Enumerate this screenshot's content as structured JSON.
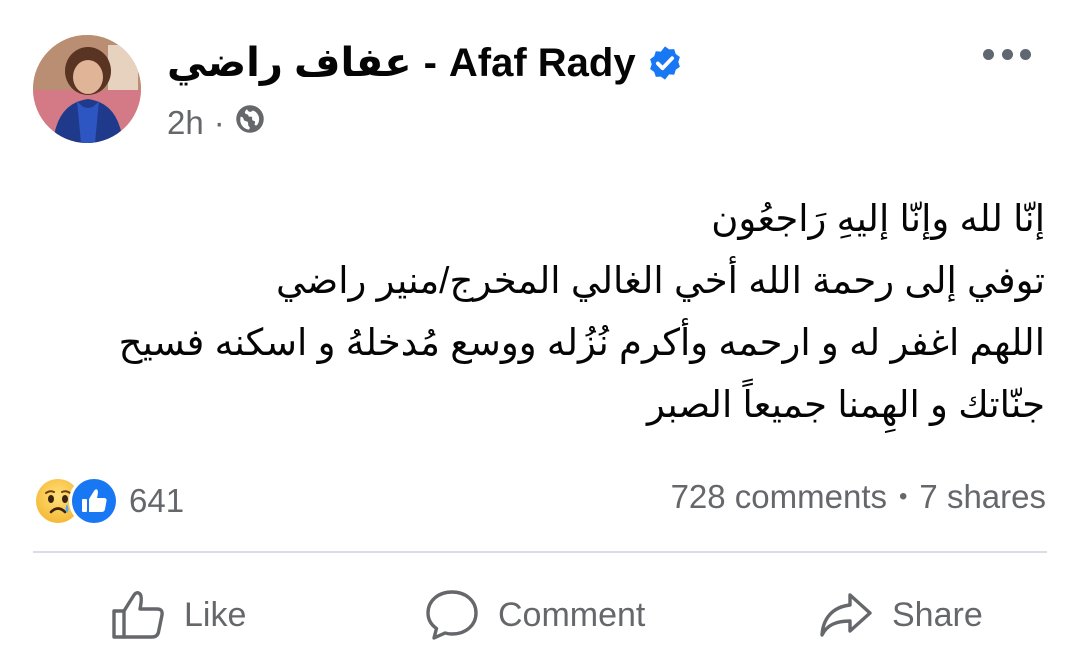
{
  "post": {
    "author_name_arabic": "عفاف راضي",
    "author_separator": "-",
    "author_name_latin": "Afaf Rady",
    "time": "2h",
    "meta_separator": "·",
    "privacy_icon": "globe-icon",
    "verified_icon": "verified-badge-icon",
    "more_icon": "more-options-icon",
    "text_lines": [
      "إنّا لله وإنّا إليهِ رَاجعُون",
      "توفي إلى رحمة الله أخي الغالي المخرج/منير راضي",
      "اللهم اغفر له و ارحمه وأكرم نُزُله ووسع مُدخلهُ و اسكنه فسيح",
      "جنّاتك و الهِمنا جميعاً الصبر"
    ]
  },
  "reactions": {
    "icons": [
      "sad-reaction-icon",
      "like-reaction-icon"
    ],
    "count": "641"
  },
  "stats": {
    "comments": "728 comments",
    "separator": "•",
    "shares": "7 shares"
  },
  "actions": {
    "like_label": "Like",
    "comment_label": "Comment",
    "share_label": "Share"
  },
  "colors": {
    "text_primary": "#050505",
    "text_secondary": "#65676b",
    "facebook_blue": "#1877f2",
    "divider": "#dadde1"
  }
}
